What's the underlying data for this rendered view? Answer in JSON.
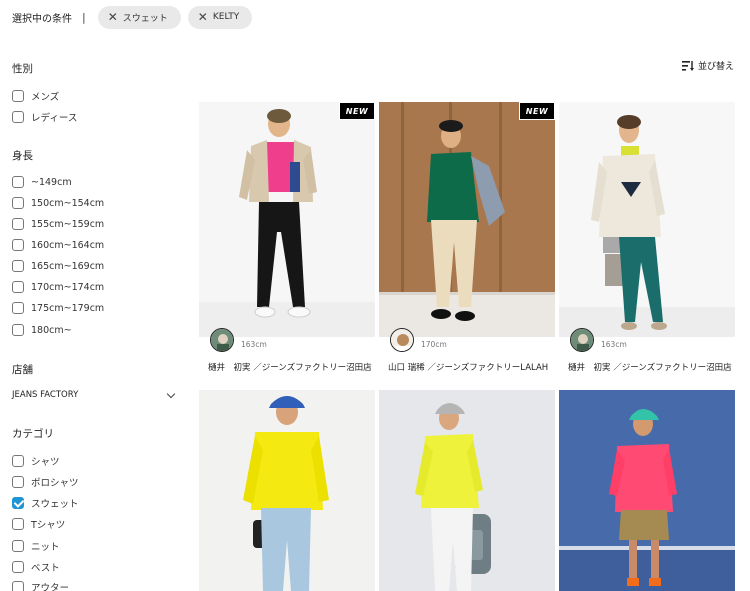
{
  "selected": {
    "label": "選択中の条件",
    "separator": "|",
    "chips": [
      {
        "label": "スウェット"
      },
      {
        "label": "KELTY"
      }
    ]
  },
  "sort": {
    "label": "並び替え",
    "icon": "sort-icon"
  },
  "filters": {
    "gender": {
      "title": "性別",
      "options": [
        {
          "label": "メンズ",
          "checked": false
        },
        {
          "label": "レディース",
          "checked": false
        }
      ]
    },
    "height": {
      "title": "身長",
      "options": [
        {
          "label": "~149cm",
          "checked": false
        },
        {
          "label": "150cm~154cm",
          "checked": false
        },
        {
          "label": "155cm~159cm",
          "checked": false
        },
        {
          "label": "160cm~164cm",
          "checked": false
        },
        {
          "label": "165cm~169cm",
          "checked": false
        },
        {
          "label": "170cm~174cm",
          "checked": false
        },
        {
          "label": "175cm~179cm",
          "checked": false
        },
        {
          "label": "180cm~",
          "checked": false
        }
      ]
    },
    "store": {
      "title": "店舗",
      "selected": "JEANS FACTORY"
    },
    "category": {
      "title": "カテゴリ",
      "options": [
        {
          "label": "シャツ",
          "checked": false
        },
        {
          "label": "ポロシャツ",
          "checked": false
        },
        {
          "label": "スウェット",
          "checked": true
        },
        {
          "label": "Tシャツ",
          "checked": false
        },
        {
          "label": "ニット",
          "checked": false
        },
        {
          "label": "ベスト",
          "checked": false
        },
        {
          "label": "アウター",
          "checked": false
        }
      ]
    }
  },
  "cards": [
    {
      "new": "NEW",
      "height": "163cm",
      "name": "樋井　初実 ／ジーンズファクトリー沼田店"
    },
    {
      "new": "NEW",
      "height": "170cm",
      "name": "山口 瑞稀 ／ジーンズファクトリーLALAH"
    },
    {
      "new": "",
      "height": "163cm",
      "name": "樋井　初実 ／ジーンズファクトリー沼田店"
    },
    {
      "new": "",
      "height": "",
      "name": ""
    },
    {
      "new": "",
      "height": "",
      "name": ""
    },
    {
      "new": "",
      "height": "",
      "name": ""
    }
  ],
  "colors": {
    "accent": "#1e95d4",
    "chip_bg": "#e9e9e9"
  }
}
